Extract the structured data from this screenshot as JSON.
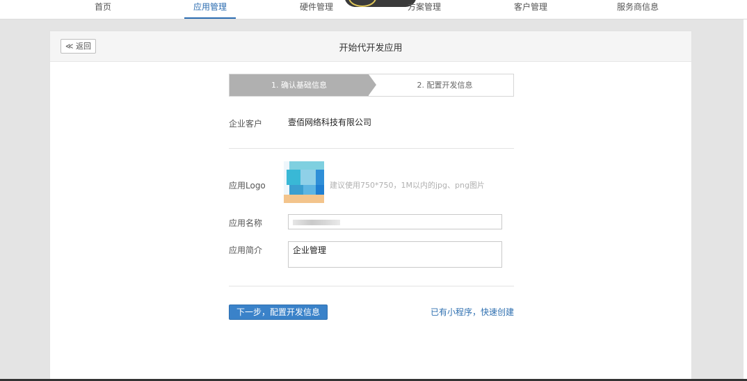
{
  "nav": {
    "items": [
      {
        "label": "首页"
      },
      {
        "label": "应用管理"
      },
      {
        "label": "硬件管理"
      },
      {
        "label": "方案管理"
      },
      {
        "label": "客户管理"
      },
      {
        "label": "服务商信息"
      }
    ],
    "active": "应用管理"
  },
  "header": {
    "back_label": "≪ 返回",
    "title": "开始代开发应用"
  },
  "steps": {
    "step1": "1. 确认基础信息",
    "step2": "2. 配置开发信息"
  },
  "form": {
    "customer_label": "企业客户",
    "customer_value": "壹佰网络科技有限公司",
    "logo_label": "应用Logo",
    "logo_hint": "建议使用750*750，1M以内的jpg、png图片",
    "name_label": "应用名称",
    "name_value": "",
    "intro_label": "应用简介",
    "intro_value": "企业管理"
  },
  "actions": {
    "next_label": "下一步，配置开发信息",
    "quick_create_label": "已有小程序，快速创建"
  },
  "colors": {
    "accent": "#3a82c9",
    "link": "#2e6fb0",
    "step_active": "#b0b0b0"
  }
}
